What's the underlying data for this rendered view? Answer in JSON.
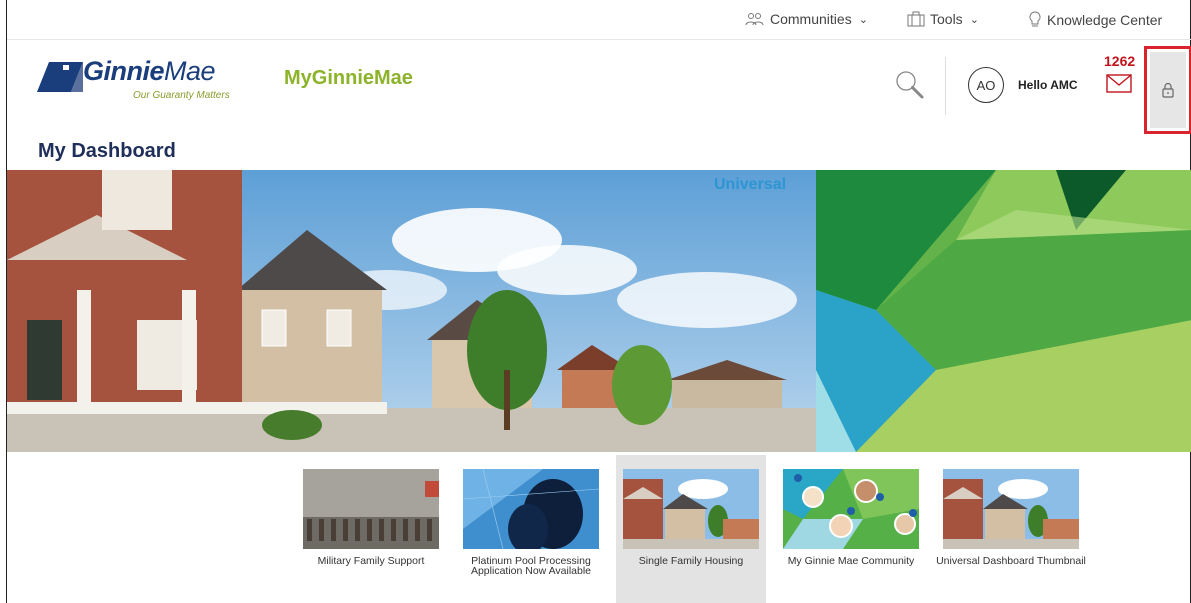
{
  "utility_nav": {
    "communities": "Communities",
    "tools": "Tools",
    "knowledge_center": "Knowledge Center"
  },
  "header": {
    "logo_ginnie": "Ginnie",
    "logo_mae": "Mae",
    "logo_tagline": "Our Guaranty Matters",
    "brand": "MyGinnieMae",
    "avatar_initials": "AO",
    "greeting": "Hello AMC",
    "message_count": "1262"
  },
  "page": {
    "title": "My Dashboard",
    "hero_label": "Universal"
  },
  "thumbnails": [
    {
      "label": "Military Family Support"
    },
    {
      "label": "Platinum Pool Processing Application Now Available"
    },
    {
      "label": "Single Family Housing"
    },
    {
      "label": "My Ginnie Mae Community"
    },
    {
      "label": "Universal Dashboard Thumbnail"
    }
  ],
  "colors": {
    "brand_navy": "#1a3e7c",
    "brand_green": "#8cb32a",
    "alert_red": "#c0131d",
    "highlight_red": "#d9232d",
    "hero_label_blue": "#2e95d3"
  },
  "icons": {
    "communities": "people-icon",
    "tools": "toolbox-icon",
    "knowledge_center": "lightbulb-icon",
    "search": "search-icon",
    "messages": "envelope-icon",
    "lock": "lock-icon"
  }
}
